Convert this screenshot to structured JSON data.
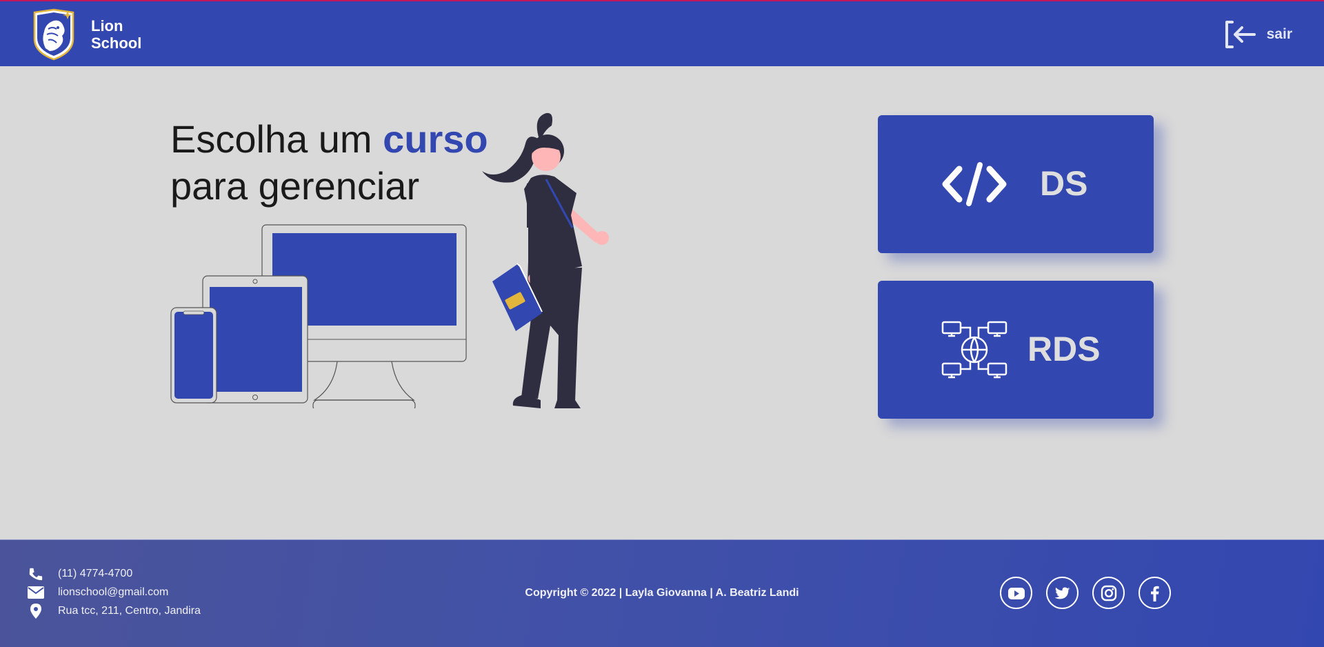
{
  "header": {
    "brand_line1": "Lion",
    "brand_line2": "School",
    "logout_label": "sair"
  },
  "main": {
    "headline_part1": "Escolha um ",
    "headline_accent": "curso",
    "headline_part2": "para gerenciar",
    "courses": [
      {
        "label": "DS",
        "icon": "code-icon"
      },
      {
        "label": "RDS",
        "icon": "network-globe-icon"
      }
    ]
  },
  "footer": {
    "phone": "(11) 4774-4700",
    "email": "lionschool@gmail.com",
    "address": "Rua tcc, 211, Centro, Jandira",
    "copyright": "Copyright © 2022 | Layla Giovanna | A. Beatriz Landi",
    "social": [
      "youtube-icon",
      "twitter-icon",
      "instagram-icon",
      "facebook-icon"
    ]
  },
  "colors": {
    "primary": "#3347b0",
    "background": "#d9d9d9",
    "card_text": "#dedede",
    "dark_figure": "#2f2e41",
    "skin": "#ffb6b6",
    "book_accent": "#e2b63c"
  }
}
